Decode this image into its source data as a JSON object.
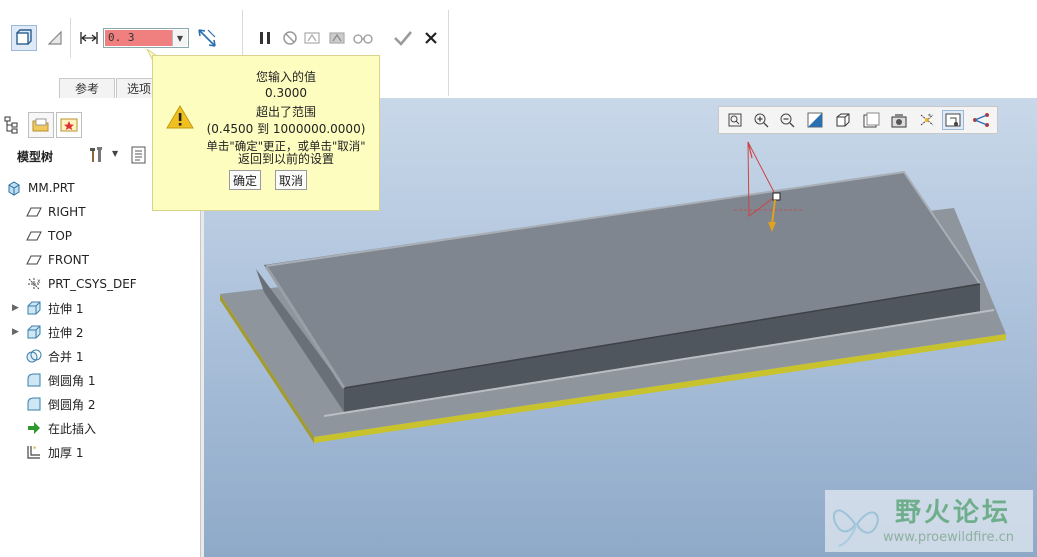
{
  "dashboard": {
    "value_input": "0. 3",
    "tabs": [
      {
        "label": "参考"
      },
      {
        "label": "选项"
      }
    ]
  },
  "popup": {
    "lines": [
      "您输入的值",
      "0.3000",
      "超出了范围",
      "(0.4500 到 1000000.0000)",
      "单击\"确定\"更正，或单击\"取消\"",
      "返回到以前的设置"
    ],
    "ok_label": "确定",
    "cancel_label": "取消"
  },
  "model_tree": {
    "header_label": "模型树",
    "items": [
      {
        "label": "MM.PRT",
        "icon": "part-icon"
      },
      {
        "label": "RIGHT",
        "icon": "datum-plane-icon"
      },
      {
        "label": "TOP",
        "icon": "datum-plane-icon"
      },
      {
        "label": "FRONT",
        "icon": "datum-plane-icon"
      },
      {
        "label": "PRT_CSYS_DEF",
        "icon": "csys-icon"
      },
      {
        "label": "拉伸 1",
        "icon": "extrude-icon"
      },
      {
        "label": "拉伸 2",
        "icon": "extrude-icon"
      },
      {
        "label": "合并 1",
        "icon": "merge-icon"
      },
      {
        "label": "倒圆角 1",
        "icon": "round-icon"
      },
      {
        "label": "倒圆角 2",
        "icon": "round-icon"
      },
      {
        "label": "在此插入",
        "icon": "insert-here-arrow-icon"
      },
      {
        "label": "加厚 1",
        "icon": "thicken-icon"
      }
    ]
  },
  "watermark": {
    "title": "野火论坛",
    "url": "www.proewildfire.cn"
  },
  "colors": {
    "invalid_value": "#f08080",
    "popup_bg": "#fdfdc0",
    "model_top": "#7f868f",
    "model_side": "#5e646c",
    "base_plate_edge": "#c8c22c",
    "graphics_bg": "#aec3dc"
  }
}
